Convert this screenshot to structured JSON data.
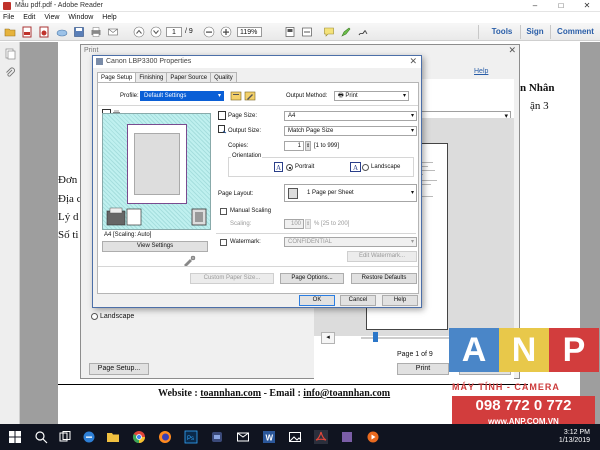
{
  "window": {
    "title": "Mẫu pdf.pdf - Adobe Reader",
    "controls": [
      "–",
      "□",
      "✕"
    ]
  },
  "menu": [
    "File",
    "Edit",
    "View",
    "Window",
    "Help"
  ],
  "toolbar": {
    "page_current": "1",
    "page_total": "/ 9",
    "zoom": "119%",
    "right_buttons": [
      "Tools",
      "Sign",
      "Comment"
    ]
  },
  "document": {
    "right_text_1": "n Nhân",
    "right_text_2": "ận 3",
    "left_lines": [
      "Đơn",
      "Địa c",
      "Lý d",
      "Số ti"
    ],
    "footer_prefix": "Website : ",
    "footer_site": "toannhan.com",
    "footer_mid": " - Email : ",
    "footer_email": "info@toannhan.com"
  },
  "print_dialog": {
    "title": "Print",
    "help": "Help",
    "landscape": "Landscape",
    "page_setup": "Page Setup...",
    "page_of": "Page 1 of 9",
    "print_btn": "Print",
    "cancel_btn": "Cancel"
  },
  "properties": {
    "title": "Canon LBP3300 Properties",
    "tabs": [
      "Page Setup",
      "Finishing",
      "Paper Source",
      "Quality"
    ],
    "profile_label": "Profile:",
    "profile_value": "Default Settings",
    "output_method_label": "Output Method:",
    "output_method_value": "Print",
    "page_size_label": "Page Size:",
    "page_size_value": "A4",
    "output_size_label": "Output Size:",
    "output_size_value": "Match Page Size",
    "copies_label": "Copies:",
    "copies_value": "1",
    "copies_range": "[1 to 999]",
    "orientation_label": "Orientation",
    "portrait": "Portrait",
    "landscape": "Landscape",
    "page_layout_label": "Page Layout:",
    "page_layout_value": "1 Page per Sheet",
    "manual_scaling": "Manual Scaling",
    "scaling_label": "Scaling:",
    "scaling_value": "100",
    "scaling_range": "% [25 to 200]",
    "watermark_label": "Watermark:",
    "watermark_value": "CONFIDENTIAL",
    "edit_watermark": "Edit Watermark...",
    "preview_caption": "A4 [Scaling: Auto]",
    "view_settings": "View Settings",
    "custom_paper_size": "Custom Paper Size...",
    "page_options": "Page Options...",
    "restore_defaults": "Restore Defaults",
    "ok": "OK",
    "cancel": "Cancel",
    "help": "Help"
  },
  "watermark_brand": {
    "letters": [
      "A",
      "N",
      "P"
    ],
    "tagline": "MÁY TÍNH - CAMERA",
    "phone": "098 772 0 772",
    "url": "www.ANP.COM.VN",
    "colors": [
      "#4a86c8",
      "#e8c84a",
      "#d23d3d"
    ]
  },
  "taskbar": {
    "time": "3:12 PM",
    "date": "1/13/2019"
  }
}
